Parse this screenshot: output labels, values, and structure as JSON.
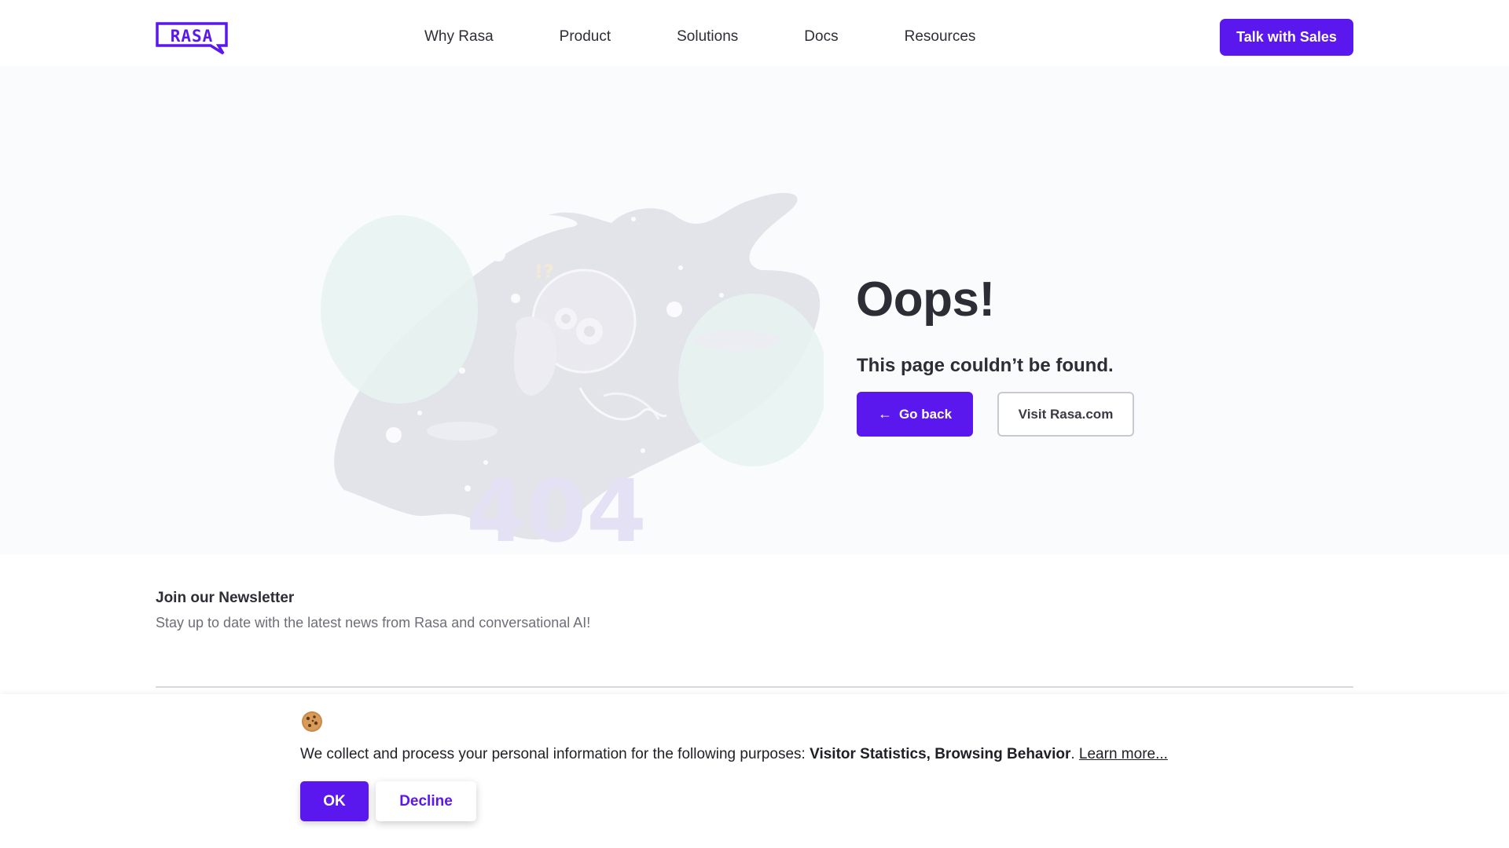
{
  "colors": {
    "brand": "#5a17ee",
    "text_dark": "#2d2d35",
    "hero_bg": "#fafbfd"
  },
  "header": {
    "logo_text": "RASA",
    "nav": [
      "Why Rasa",
      "Product",
      "Solutions",
      "Docs",
      "Resources"
    ],
    "cta_label": "Talk with Sales"
  },
  "hero": {
    "illustration_text": "404",
    "title": "Oops!",
    "subtitle": "This page couldn’t be found.",
    "back_label": "Go back",
    "back_icon": "arrow-left-icon",
    "visit_label": "Visit Rasa.com"
  },
  "newsletter": {
    "title": "Join our Newsletter",
    "subtitle": "Stay up to date with the latest news from Rasa and conversational AI!"
  },
  "cookie": {
    "icon": "cookie-icon",
    "text_prefix": "We collect and process your personal information for the following purposes: ",
    "purposes": "Visitor Statistics, Browsing Behavior",
    "text_suffix": ". ",
    "learn_more": "Learn more...",
    "ok_label": "OK",
    "decline_label": "Decline"
  }
}
